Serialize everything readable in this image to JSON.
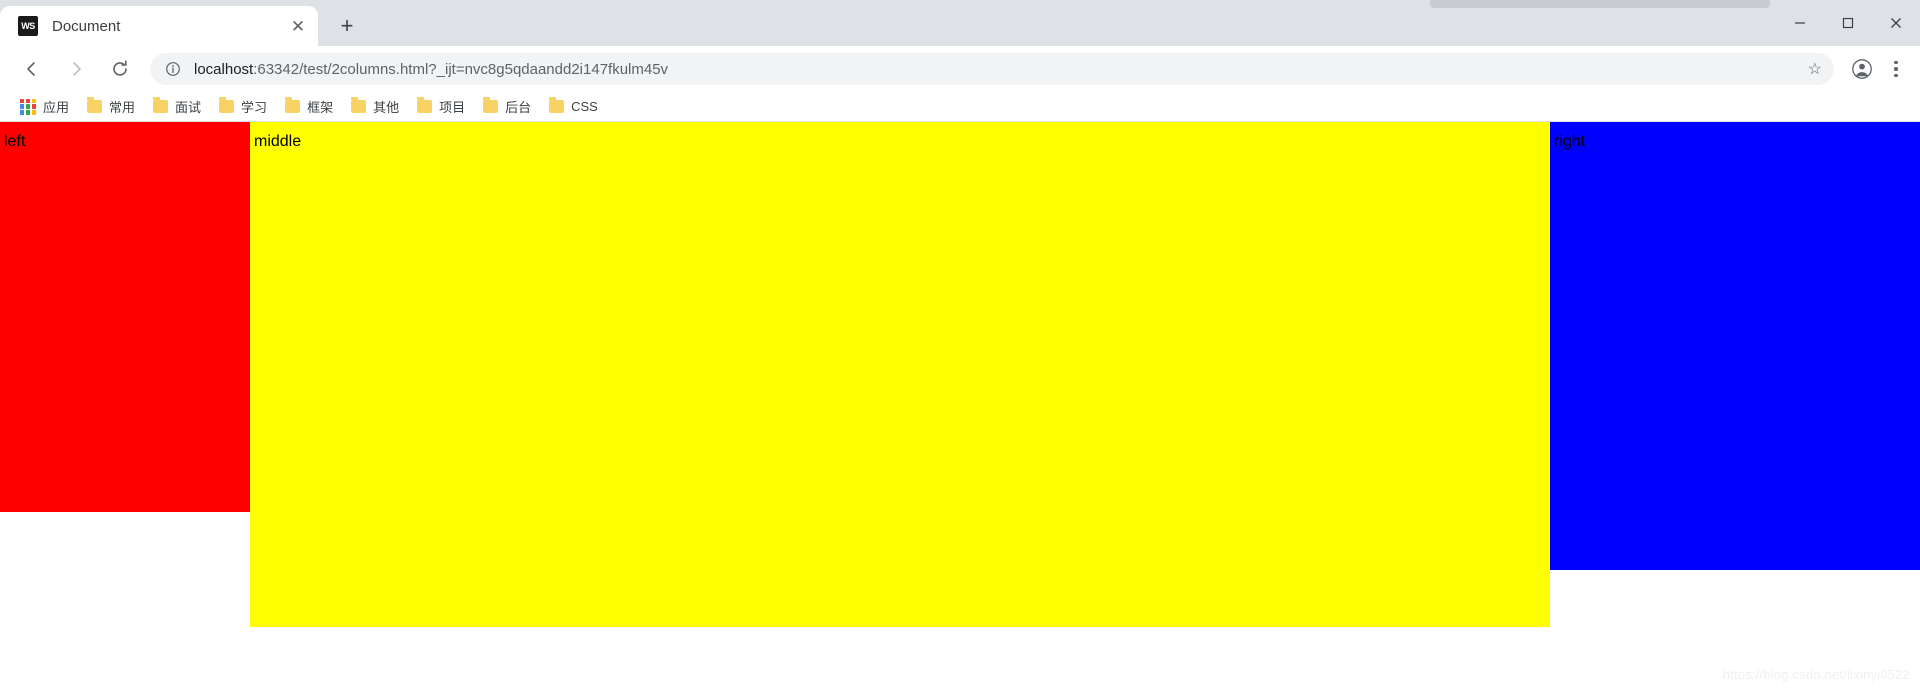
{
  "browser": {
    "tab": {
      "favicon_text": "WS",
      "favicon_icon": "webstorm-favicon",
      "title": "Document",
      "close_icon": "✕"
    },
    "new_tab_icon": "+",
    "window_controls": {
      "minimize_icon": "─",
      "maximize_icon": "☐",
      "close_icon": "✕"
    },
    "toolbar": {
      "back_icon": "←",
      "forward_icon": "→",
      "reload_icon": "⟳",
      "info_icon": "ⓘ",
      "star_icon": "☆",
      "profile_icon": "●",
      "menu_icon": "kebab-menu",
      "url_host": "localhost",
      "url_rest": ":63342/test/2columns.html?_ijt=nvc8g5qdaandd2i147fkulm45v",
      "url_full": "localhost:63342/test/2columns.html?_ijt=nvc8g5qdaandd2i147fkulm45v"
    },
    "bookmarks": [
      {
        "label": "应用",
        "icon": "apps-grid-icon"
      },
      {
        "label": "常用",
        "icon": "folder-icon"
      },
      {
        "label": "面试",
        "icon": "folder-icon"
      },
      {
        "label": "学习",
        "icon": "folder-icon"
      },
      {
        "label": "框架",
        "icon": "folder-icon"
      },
      {
        "label": "其他",
        "icon": "folder-icon"
      },
      {
        "label": "项目",
        "icon": "folder-icon"
      },
      {
        "label": "后台",
        "icon": "folder-icon"
      },
      {
        "label": "CSS",
        "icon": "folder-icon"
      }
    ]
  },
  "page": {
    "columns": [
      {
        "label": "left",
        "color": "#ff0000"
      },
      {
        "label": "middle",
        "color": "#ffff00"
      },
      {
        "label": "right",
        "color": "#0000ff"
      }
    ],
    "watermark": "https://blog.csdn.net/lixinyi0522"
  }
}
